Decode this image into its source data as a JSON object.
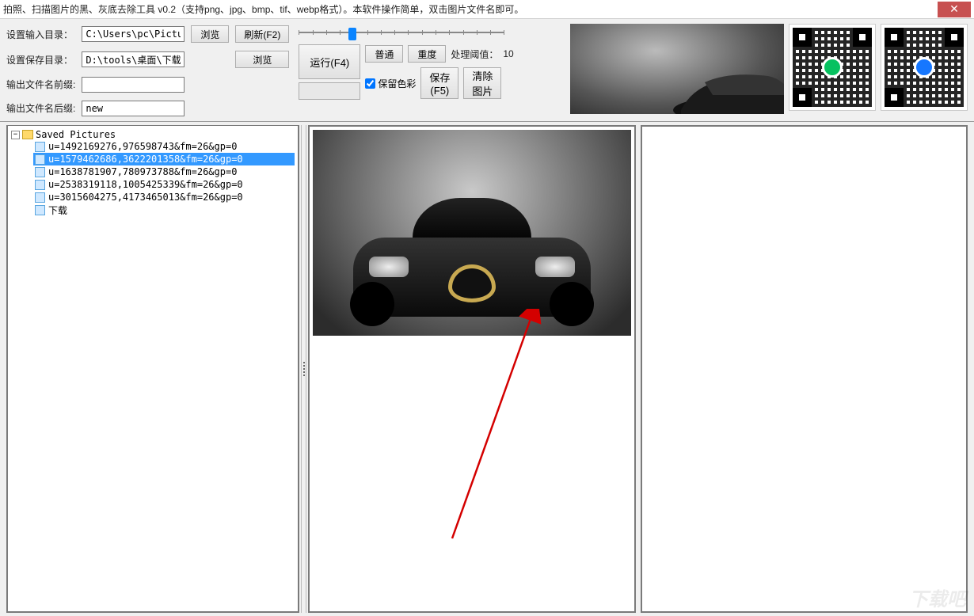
{
  "window": {
    "title": "拍照、扫描图片的黑、灰底去除工具 v0.2（支持png、jpg、bmp、tif、webp格式）。本软件操作简单，双击图片文件名即可。"
  },
  "settings": {
    "input_dir_label": "设置输入目录：",
    "input_dir_value": "C:\\Users\\pc\\Pictures",
    "save_dir_label": "设置保存目录：",
    "save_dir_value": "D:\\tools\\桌面\\下载吧",
    "prefix_label": "输出文件名前缀:",
    "prefix_value": "",
    "suffix_label": "输出文件名后缀:",
    "suffix_value": "new",
    "browse_btn": "浏览",
    "refresh_btn": "刷新(F2)"
  },
  "controls": {
    "run_btn": "运行(F4)",
    "normal_btn": "普通",
    "heavy_btn": "重度",
    "threshold_label": "处理阈值：",
    "threshold_value": "10",
    "keep_color_label": "保留色彩",
    "save_btn": "保存\n(F5)",
    "clear_btn": "清除\n图片"
  },
  "tree": {
    "root": "Saved Pictures",
    "items": [
      "u=1492169276,976598743&fm=26&gp=0",
      "u=1579462686,3622201358&fm=26&gp=0",
      "u=1638781907,780973788&fm=26&gp=0",
      "u=2538319118,1005425339&fm=26&gp=0",
      "u=3015604275,4173465013&fm=26&gp=0",
      "下载"
    ],
    "selected_index": 1
  },
  "watermark": "下载吧"
}
